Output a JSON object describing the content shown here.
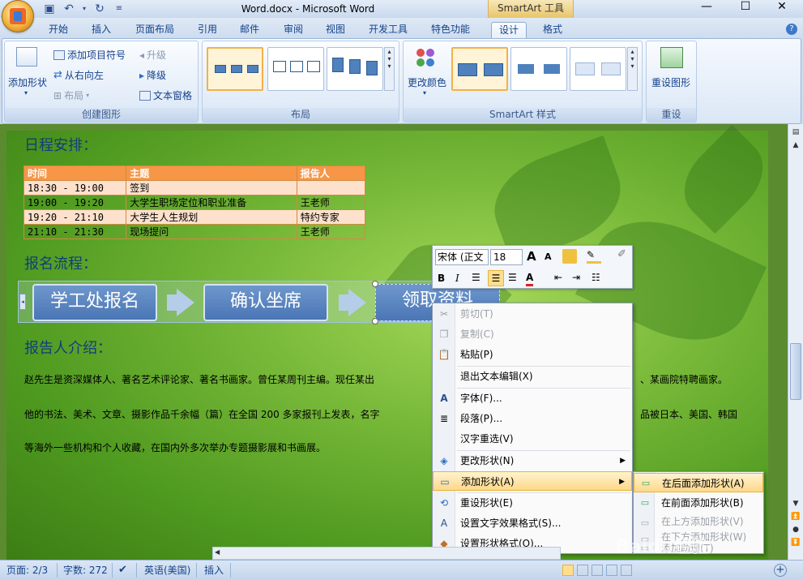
{
  "window": {
    "title": "Word.docx - Microsoft Word",
    "contextual_tab_group": "SmartArt 工具",
    "controls": {
      "minimize": "—",
      "maximize": "☐",
      "close": "✕"
    }
  },
  "quick_access": [
    "save-icon",
    "undo-icon",
    "redo-icon",
    "customize-icon"
  ],
  "tabs": [
    {
      "label": "开始"
    },
    {
      "label": "插入"
    },
    {
      "label": "页面布局"
    },
    {
      "label": "引用"
    },
    {
      "label": "邮件"
    },
    {
      "label": "审阅"
    },
    {
      "label": "视图"
    },
    {
      "label": "开发工具"
    },
    {
      "label": "特色功能"
    },
    {
      "label": "设计",
      "active": true
    },
    {
      "label": "格式"
    }
  ],
  "ribbon": {
    "create_graphic": {
      "label": "创建图形",
      "add_shape": "添加形状",
      "add_bullet": "添加项目符号",
      "right_to_left": "从右向左",
      "layout": "布局",
      "promote": "升级",
      "demote": "降级",
      "text_pane": "文本窗格"
    },
    "layouts": {
      "label": "布局"
    },
    "styles": {
      "label": "SmartArt 样式",
      "change_colors": "更改颜色"
    },
    "reset": {
      "label": "重设",
      "reset_graphic": "重设图形"
    }
  },
  "document": {
    "schedule_heading": "日程安排：",
    "schedule": {
      "headers": [
        "时间",
        "主题",
        "报告人"
      ],
      "rows": [
        [
          "18:30 - 19:00",
          "签到",
          ""
        ],
        [
          "19:00 - 19:20",
          "大学生职场定位和职业准备",
          "王老师"
        ],
        [
          "19:20 - 21:10",
          "大学生人生规划",
          "特约专家"
        ],
        [
          "21:10 - 21:30",
          "现场提问",
          "王老师"
        ]
      ]
    },
    "signup_heading": "报名流程：",
    "smartart_steps": [
      "学工处报名",
      "确认坐席",
      "领取资料"
    ],
    "speaker_heading": "报告人介绍：",
    "para1_left": "赵先生是资深媒体人、著名艺术评论家、著名书画家。曾任某周刊主编。现任某出",
    "para1_right": "、某画院特聘画家。",
    "para2_left": "他的书法、美术、文章、摄影作品千余幅（篇）在全国 200 多家报刊上发表，名字",
    "para2_right": "品被日本、美国、韩国",
    "para3": "等海外一些机构和个人收藏，在国内外多次举办专题摄影展和书画展。"
  },
  "mini_toolbar": {
    "font_name": "宋体 (正文",
    "font_size": "18",
    "grow": "A",
    "shrink": "A",
    "bold": "B",
    "italic": "I"
  },
  "context_menu": {
    "items": [
      {
        "label": "剪切(T)",
        "icon": "scissors-icon",
        "disabled": true
      },
      {
        "label": "复制(C)",
        "icon": "copy-icon",
        "disabled": true
      },
      {
        "label": "粘贴(P)",
        "icon": "paste-icon"
      },
      {
        "label": "退出文本编辑(X)",
        "icon": ""
      },
      {
        "label": "字体(F)...",
        "icon": "font-icon"
      },
      {
        "label": "段落(P)...",
        "icon": "paragraph-icon"
      },
      {
        "label": "汉字重选(V)",
        "icon": ""
      },
      {
        "label": "更改形状(N)",
        "icon": "change-shape-icon",
        "submenu": true
      },
      {
        "label": "添加形状(A)",
        "icon": "add-shape-icon",
        "submenu": true,
        "highlighted": true
      },
      {
        "label": "重设形状(E)",
        "icon": "reset-shape-icon"
      },
      {
        "label": "设置文字效果格式(S)...",
        "icon": "text-effects-icon"
      },
      {
        "label": "设置形状格式(O)...",
        "icon": "format-shape-icon"
      }
    ],
    "submenu": [
      {
        "label": "在后面添加形状(A)",
        "highlighted": true
      },
      {
        "label": "在前面添加形状(B)"
      },
      {
        "label": "在上方添加形状(V)",
        "disabled": true
      },
      {
        "label": "在下方添加形状(W)",
        "disabled": true
      },
      {
        "label": "添加助理(T)",
        "disabled": true
      }
    ]
  },
  "status_bar": {
    "page": "页面: 2/3",
    "words": "字数: 272",
    "language": "英语(美国)",
    "mode": "插入"
  },
  "watermark": "Baidu经验"
}
